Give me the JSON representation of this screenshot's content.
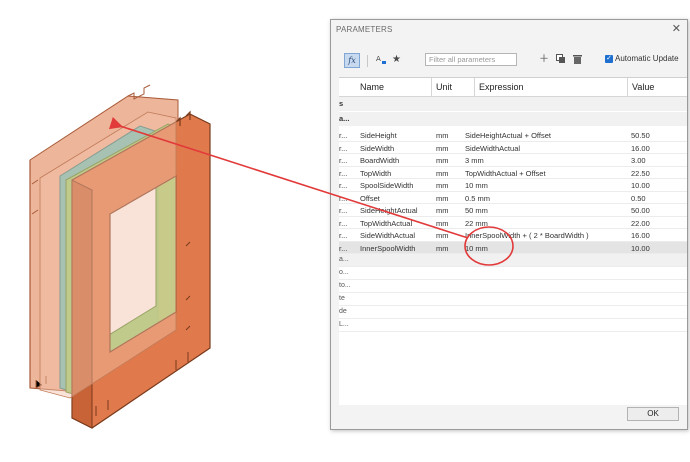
{
  "dialog": {
    "title": "PARAMETERS",
    "close_glyph": "✕",
    "fx_label": "fx",
    "search_placeholder": "Filter all parameters",
    "auto_update_label": "Automatic Update",
    "auto_update_checked": true,
    "ok_label": "OK",
    "icons": [
      "function-icon",
      "sort-icon",
      "favorite-star-icon",
      "add-icon",
      "copy-icon",
      "delete-icon"
    ]
  },
  "columns": {
    "name": "Name",
    "unit": "Unit",
    "expression": "Expression",
    "value": "Value"
  },
  "groups": [
    "s",
    "a..."
  ],
  "rows": [
    {
      "prefix": "r...",
      "name": "SideHeight",
      "unit": "mm",
      "expression": "SideHeightActual + Offset",
      "value": "50.50"
    },
    {
      "prefix": "r...",
      "name": "SideWidth",
      "unit": "mm",
      "expression": "SideWidthActual",
      "value": "16.00"
    },
    {
      "prefix": "r...",
      "name": "BoardWidth",
      "unit": "mm",
      "expression": "3 mm",
      "value": "3.00"
    },
    {
      "prefix": "r...",
      "name": "TopWidth",
      "unit": "mm",
      "expression": "TopWidthActual + Offset",
      "value": "22.50"
    },
    {
      "prefix": "r...",
      "name": "SpoolSideWidth",
      "unit": "mm",
      "expression": "10 mm",
      "value": "10.00"
    },
    {
      "prefix": "r...",
      "name": "Offset",
      "unit": "mm",
      "expression": "0.5 mm",
      "value": "0.50"
    },
    {
      "prefix": "r...",
      "name": "SideHeightActual",
      "unit": "mm",
      "expression": "50 mm",
      "value": "50.00"
    },
    {
      "prefix": "r...",
      "name": "TopWidthActual",
      "unit": "mm",
      "expression": "22 mm",
      "value": "22.00"
    },
    {
      "prefix": "r...",
      "name": "SideWidthActual",
      "unit": "mm",
      "expression": "InnerSpoolWidth + ( 2 * BoardWidth )",
      "value": "16.00"
    },
    {
      "prefix": "r...",
      "name": "InnerSpoolWidth",
      "unit": "mm",
      "expression": "10 mm",
      "value": "10.00",
      "selected": true
    }
  ],
  "stubs": [
    "a...",
    "o...",
    "to...",
    "te",
    "de",
    "L..."
  ],
  "colors": {
    "panel_back": "#eaa888",
    "panel_front": "#e07a4c",
    "panel_edge": "#7a3a1c",
    "green": "#9dd46c",
    "cyan": "#5bc4c0",
    "annotation_red": "#e23a3a",
    "dialog_bg": "#f3f3f3"
  }
}
